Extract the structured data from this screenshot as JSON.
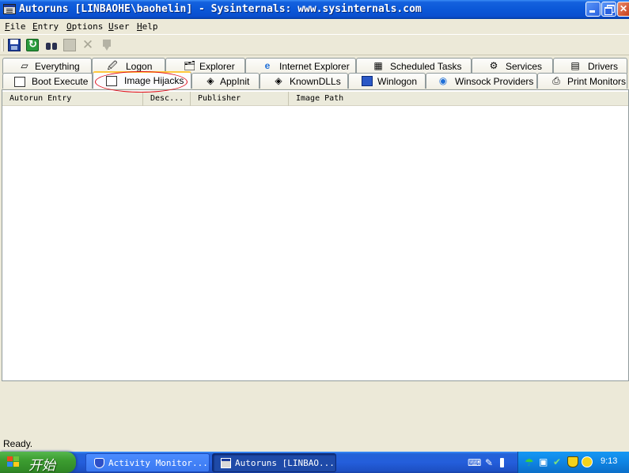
{
  "window": {
    "title": "Autoruns [LINBAOHE\\baohelin] - Sysinternals: www.sysinternals.com",
    "icon": "autoruns-app-icon"
  },
  "menu": [
    {
      "label": "File",
      "key": "F",
      "rest": "ile"
    },
    {
      "label": "Entry",
      "key": "E",
      "rest": "ntry"
    },
    {
      "label": "Options",
      "key": "O",
      "rest": "ptions"
    },
    {
      "label": "User",
      "key": "U",
      "rest": "ser"
    },
    {
      "label": "Help",
      "key": "H",
      "rest": "elp"
    }
  ],
  "toolbar": [
    "save-icon",
    "refresh-icon",
    "find-icon",
    "properties-icon",
    "delete-icon",
    "jump-to-icon"
  ],
  "tabs": {
    "row1": [
      "Everything",
      "Logon",
      "Explorer",
      "Internet Explorer",
      "Scheduled Tasks",
      "Services",
      "Drivers"
    ],
    "row2": [
      "Boot Execute",
      "Image Hijacks",
      "AppInit",
      "KnownDLLs",
      "Winlogon",
      "Winsock Providers",
      "Print Monitors"
    ],
    "active": "Image Hijacks",
    "highlight_color": "#e0101a"
  },
  "list": {
    "columns": [
      "Autorun Entry",
      "Desc...",
      "Publisher",
      "Image Path"
    ],
    "rows": []
  },
  "status": "Ready.",
  "taskbar": {
    "start_label": "开始",
    "tasks": [
      {
        "label": "Activity Monitor...",
        "icon": "shield-icon"
      },
      {
        "label": "Autoruns [LINBAO...",
        "icon": "autoruns-app-icon",
        "active": true
      }
    ],
    "clock": "9:13"
  }
}
